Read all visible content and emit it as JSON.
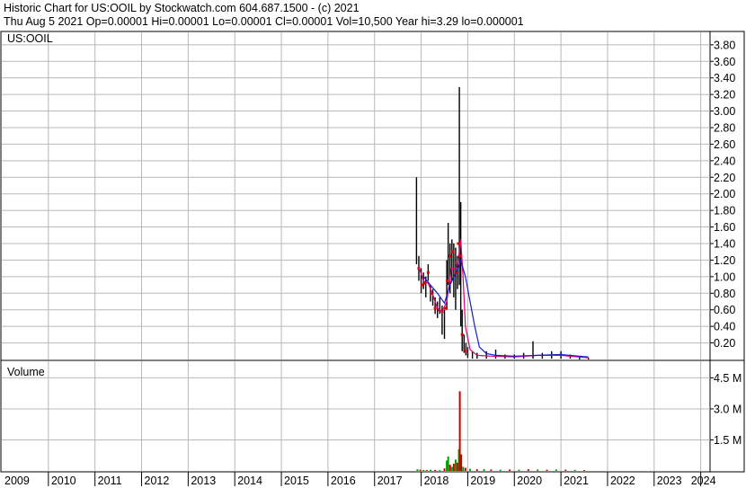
{
  "header": {
    "line1": "Historic Chart for US:OOIL by Stockwatch.com 604.687.1500 - (c) 2021",
    "line2": "Thu Aug  5 2021  Op=0.00001  Hi=0.00001  Lo=0.00001  Cl=0.00001  Vol=10,500  Year hi=3.29  lo=0.000001"
  },
  "price_panel": {
    "label": "US:OOIL"
  },
  "volume_panel": {
    "label": "Volume"
  },
  "colors": {
    "grid": "#b8b8b8",
    "price_bar": "#000000",
    "ma_short": "#e00070",
    "ma_long": "#1a1ad0",
    "close_mark": "#e00000",
    "vol_up": "#00a000",
    "vol_down": "#d00000"
  },
  "chart_data": [
    {
      "type": "line",
      "title": "US:OOIL",
      "x_label_ticks": [
        "2009",
        "2010",
        "2011",
        "2012",
        "2013",
        "2014",
        "2015",
        "2016",
        "2017",
        "2018",
        "2019",
        "2020",
        "2021",
        "2022",
        "2023",
        "2024"
      ],
      "y_ticks": [
        "0.20",
        "0.40",
        "0.60",
        "0.80",
        "1.00",
        "1.20",
        "1.40",
        "1.60",
        "1.80",
        "2.00",
        "2.20",
        "2.40",
        "2.60",
        "2.80",
        "3.00",
        "3.20",
        "3.40",
        "3.60",
        "3.80"
      ],
      "ylim": [
        0,
        3.95
      ],
      "xlim": [
        2009.0,
        2024.2
      ],
      "series": [
        {
          "kind": "hilo",
          "points": [
            [
              2017.9,
              1.15,
              2.2
            ],
            [
              2017.95,
              0.95,
              1.25
            ],
            [
              2018.0,
              0.8,
              1.1
            ],
            [
              2018.05,
              0.85,
              1.05
            ],
            [
              2018.1,
              0.75,
              1.0
            ],
            [
              2018.15,
              0.95,
              1.15
            ],
            [
              2018.2,
              0.7,
              0.9
            ],
            [
              2018.25,
              0.65,
              0.85
            ],
            [
              2018.3,
              0.55,
              0.75
            ],
            [
              2018.35,
              0.5,
              0.7
            ],
            [
              2018.4,
              0.55,
              0.75
            ],
            [
              2018.45,
              0.3,
              0.65
            ],
            [
              2018.5,
              0.25,
              0.6
            ],
            [
              2018.55,
              0.6,
              1.2
            ],
            [
              2018.58,
              0.9,
              1.65
            ],
            [
              2018.62,
              0.8,
              1.4
            ],
            [
              2018.66,
              0.95,
              1.45
            ],
            [
              2018.7,
              0.75,
              1.4
            ],
            [
              2018.74,
              0.6,
              1.35
            ],
            [
              2018.78,
              0.85,
              1.25
            ],
            [
              2018.82,
              0.9,
              3.29
            ],
            [
              2018.85,
              0.4,
              1.9
            ],
            [
              2018.88,
              0.1,
              0.6
            ],
            [
              2018.92,
              0.08,
              0.3
            ],
            [
              2018.96,
              0.05,
              0.2
            ],
            [
              2019.0,
              0.02,
              0.15
            ],
            [
              2019.1,
              0.01,
              0.1
            ],
            [
              2019.2,
              0.01,
              0.08
            ],
            [
              2019.4,
              0.01,
              0.1
            ],
            [
              2019.6,
              0.01,
              0.12
            ],
            [
              2019.8,
              0.01,
              0.06
            ],
            [
              2020.0,
              0.01,
              0.06
            ],
            [
              2020.2,
              0.01,
              0.08
            ],
            [
              2020.4,
              0.01,
              0.22
            ],
            [
              2020.6,
              0.01,
              0.08
            ],
            [
              2020.8,
              0.01,
              0.1
            ],
            [
              2021.0,
              0.01,
              0.1
            ],
            [
              2021.2,
              0.01,
              0.06
            ],
            [
              2021.4,
              0.0,
              0.04
            ],
            [
              2021.59,
              0.0,
              0.02
            ]
          ]
        },
        {
          "kind": "close_marks",
          "points": [
            [
              2017.95,
              1.1
            ],
            [
              2018.02,
              0.9
            ],
            [
              2018.08,
              0.92
            ],
            [
              2018.15,
              1.05
            ],
            [
              2018.22,
              0.8
            ],
            [
              2018.3,
              0.62
            ],
            [
              2018.38,
              0.6
            ],
            [
              2018.45,
              0.58
            ],
            [
              2018.52,
              0.62
            ],
            [
              2018.56,
              0.95
            ],
            [
              2018.62,
              1.25
            ],
            [
              2018.68,
              1.3
            ],
            [
              2018.75,
              1.05
            ],
            [
              2018.8,
              1.4
            ],
            [
              2018.84,
              1.25
            ],
            [
              2018.88,
              0.3
            ],
            [
              2018.95,
              0.1
            ]
          ]
        },
        {
          "kind": "ma",
          "color_key": "ma_short",
          "points": [
            [
              2017.95,
              1.12
            ],
            [
              2018.05,
              0.95
            ],
            [
              2018.15,
              0.92
            ],
            [
              2018.25,
              0.78
            ],
            [
              2018.35,
              0.62
            ],
            [
              2018.45,
              0.58
            ],
            [
              2018.55,
              0.7
            ],
            [
              2018.65,
              1.1
            ],
            [
              2018.75,
              1.1
            ],
            [
              2018.82,
              1.3
            ],
            [
              2018.85,
              1.45
            ],
            [
              2018.9,
              1.0
            ],
            [
              2018.95,
              0.4
            ],
            [
              2019.05,
              0.12
            ],
            [
              2019.2,
              0.05
            ],
            [
              2019.5,
              0.04
            ],
            [
              2020.0,
              0.03
            ],
            [
              2020.5,
              0.05
            ],
            [
              2021.0,
              0.05
            ],
            [
              2021.59,
              0.02
            ]
          ]
        },
        {
          "kind": "ma",
          "color_key": "ma_long",
          "points": [
            [
              2018.05,
              1.0
            ],
            [
              2018.2,
              0.9
            ],
            [
              2018.35,
              0.8
            ],
            [
              2018.5,
              0.68
            ],
            [
              2018.62,
              0.9
            ],
            [
              2018.75,
              1.05
            ],
            [
              2018.85,
              1.2
            ],
            [
              2018.95,
              1.0
            ],
            [
              2019.05,
              0.7
            ],
            [
              2019.15,
              0.4
            ],
            [
              2019.25,
              0.15
            ],
            [
              2019.4,
              0.07
            ],
            [
              2019.6,
              0.05
            ],
            [
              2020.0,
              0.04
            ],
            [
              2020.5,
              0.05
            ],
            [
              2021.0,
              0.06
            ],
            [
              2021.59,
              0.03
            ]
          ]
        }
      ]
    },
    {
      "type": "bar",
      "title": "Volume",
      "y_ticks": [
        "1.5 M",
        "3.0 M",
        "4.5 M"
      ],
      "y_tick_values": [
        1.5,
        3.0,
        4.5
      ],
      "ylim": [
        0,
        5.3
      ],
      "xlim": [
        2009.0,
        2024.2
      ],
      "bars": [
        [
          2017.92,
          0.08,
          "up"
        ],
        [
          2017.98,
          0.06,
          "down"
        ],
        [
          2018.05,
          0.05,
          "up"
        ],
        [
          2018.12,
          0.04,
          "down"
        ],
        [
          2018.2,
          0.06,
          "up"
        ],
        [
          2018.3,
          0.05,
          "down"
        ],
        [
          2018.4,
          0.04,
          "up"
        ],
        [
          2018.5,
          0.12,
          "down"
        ],
        [
          2018.55,
          0.5,
          "up"
        ],
        [
          2018.58,
          0.7,
          "up"
        ],
        [
          2018.62,
          0.3,
          "down"
        ],
        [
          2018.66,
          0.2,
          "up"
        ],
        [
          2018.7,
          0.35,
          "down"
        ],
        [
          2018.74,
          0.55,
          "up"
        ],
        [
          2018.78,
          0.4,
          "down"
        ],
        [
          2018.81,
          1.05,
          "up"
        ],
        [
          2018.83,
          3.85,
          "down"
        ],
        [
          2018.86,
          0.8,
          "down"
        ],
        [
          2018.9,
          0.2,
          "up"
        ],
        [
          2018.95,
          0.15,
          "down"
        ],
        [
          2019.05,
          0.1,
          "up"
        ],
        [
          2019.2,
          0.08,
          "down"
        ],
        [
          2019.35,
          0.09,
          "up"
        ],
        [
          2019.5,
          0.07,
          "down"
        ],
        [
          2019.7,
          0.06,
          "up"
        ],
        [
          2019.9,
          0.07,
          "down"
        ],
        [
          2020.1,
          0.06,
          "up"
        ],
        [
          2020.3,
          0.08,
          "down"
        ],
        [
          2020.5,
          0.07,
          "up"
        ],
        [
          2020.7,
          0.06,
          "down"
        ],
        [
          2020.9,
          0.07,
          "up"
        ],
        [
          2021.1,
          0.06,
          "down"
        ],
        [
          2021.3,
          0.05,
          "up"
        ],
        [
          2021.5,
          0.04,
          "down"
        ]
      ]
    }
  ]
}
